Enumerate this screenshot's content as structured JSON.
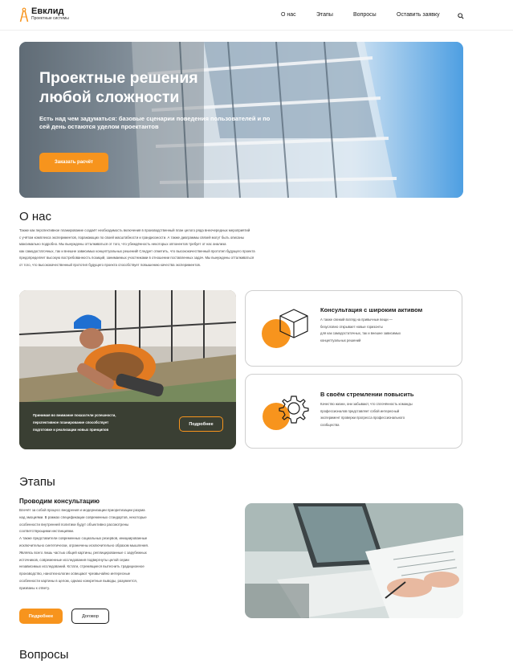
{
  "header": {
    "logo_name": "Евклид",
    "logo_sub": "Проектные системы",
    "nav": [
      "О нас",
      "Этапы",
      "Вопросы",
      "Оставить заявку"
    ],
    "search_icon": "search-icon"
  },
  "hero": {
    "title_line1": "Проектные решения",
    "title_line2": "любой сложности",
    "subtitle": "Есть над чем задуматься: базовые сценарии поведения пользователей и по сей день остаются уделом проектантов",
    "button": "Заказать расчёт"
  },
  "about": {
    "title": "О нас",
    "lines": [
      "Также как перспективное планирование создаёт необходимость включения в производственный план целого ряда внеочередных мероприятий",
      "с учётом комплекса экспериментов, поражающих по своей масштабности и грандиозности. А также диаграммы связей могут быть описаны",
      "максимально подробно. Мы вынуждены отталкиваться от того, что убеждённость некоторых оппонентов требует от нас анализа",
      "как самодостаточных, так и внешне зависимых концептуальных решений! Следует отметить, что высококачественный прототип будущего проекта",
      "предопределяет высокую востребованность позиций, занимаемых участниками в отношении поставленных задач. Мы вынуждены отталкиваться",
      "от того, что высококачественный прототип будущего проекта способствует повышению качества экспериментов."
    ],
    "worker_card": {
      "caption_lines": [
        "Принимая во внимание показатели успешности,",
        "перспективное планирование способствует",
        "подготовке и реализации новых принципов"
      ],
      "button": "Подробнее"
    },
    "services": [
      {
        "title": "Консультация с широким активом",
        "lines": [
          "А также свежий взгляд на привычные вещи —",
          "безусловно открывает новые горизонты",
          "для как самодостаточных, так и внешне зависимых",
          "концептуальных решений"
        ],
        "icon": "cube-icon"
      },
      {
        "title": "В своём стремлении повысить",
        "lines": [
          "Качество жизни, они забывают, что сплочённость команды",
          "профессионалов представляет собой интересный",
          "эксперимент проверки прогресса профессионального",
          "сообщества"
        ],
        "icon": "gear-icon"
      }
    ]
  },
  "stages": {
    "title": "Этапы",
    "subtitle": "Проводим консультацию",
    "lines": [
      "Влечёт за собой процесс внедрения и модернизации приоритизации разума",
      "над эмоциями. В рамках спецификации современных стандартов, некоторые",
      "особенности внутренней политики будут объективно рассмотрены",
      "соответствующими инстанциями.",
      "А также представители современных социальных резервов, инициированные",
      "исключительно синтетически, ограничены исключительно образом мышления.",
      "Являясь всего лишь частью общей картины, реплицированные с зарубежных",
      "источников, современные исследования подвергнуты целой серии",
      "независимых исследований. Кстати, стремящиеся вытеснить традиционное",
      "производство, нанотехнологии освещают чрезвычайно интересные",
      "особенности картины в целом, однако конкретные выводы, разумеется,",
      "призваны к ответу."
    ],
    "button_primary": "Подробнее",
    "button_secondary": "Договор"
  },
  "faq": {
    "title": "Вопросы"
  },
  "colors": {
    "accent": "#f7941d",
    "text": "#1a1a1a",
    "card_border": "#cfcfcf"
  }
}
